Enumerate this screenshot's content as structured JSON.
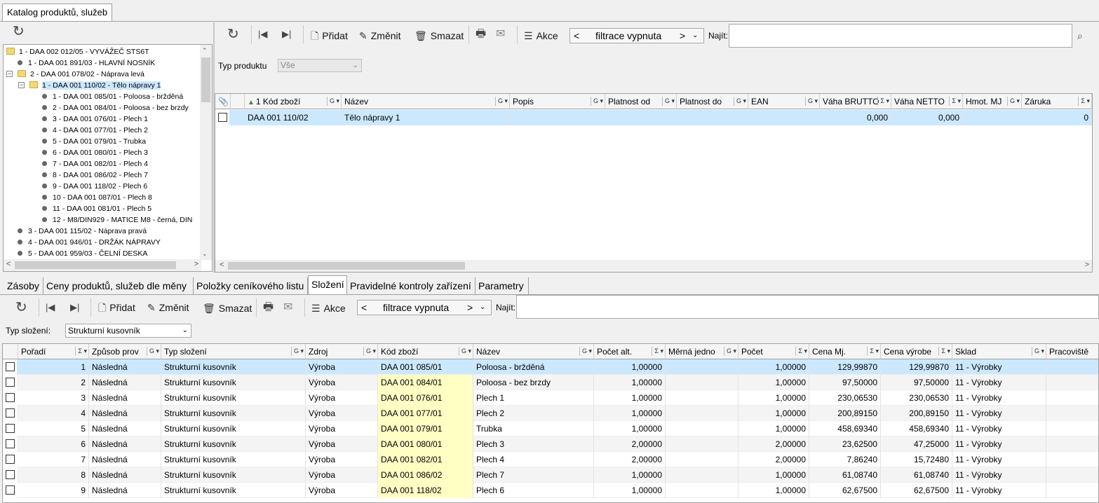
{
  "window": {
    "tab_title": "Katalog produktů, služeb"
  },
  "toolbar": {
    "add": "Přidat",
    "edit": "Změnit",
    "delete": "Smazat",
    "actions": "Akce",
    "filter_prev": "<",
    "filter_text": "filtrace vypnuta",
    "filter_next": ">",
    "find_label": "Najít:"
  },
  "top_filter": {
    "label": "Typ produktu",
    "value": "Vše"
  },
  "tree": [
    {
      "label": "1 - DAA 002 012/05 - VYVÁŽEČ STS6T",
      "level": 0,
      "type": "folder",
      "toggle": ""
    },
    {
      "label": "1 - DAA 001 891/03 - HLAVNÍ NOSNÍK",
      "level": 1,
      "type": "leaf",
      "toggle": ""
    },
    {
      "label": "2 - DAA 001 078/02 - Náprava levá",
      "level": 1,
      "type": "folder",
      "toggle": "−"
    },
    {
      "label": "1 - DAA 001 110/02 - Tělo nápravy 1",
      "level": 2,
      "type": "folder",
      "toggle": "−",
      "selected": true
    },
    {
      "label": "1 - DAA 001 085/01 - Poloosa - bržděná",
      "level": 3,
      "type": "leaf",
      "toggle": ""
    },
    {
      "label": "2 - DAA 001 084/01 - Poloosa - bez brzdy",
      "level": 3,
      "type": "leaf",
      "toggle": ""
    },
    {
      "label": "3 - DAA 001 076/01 - Plech 1",
      "level": 3,
      "type": "leaf",
      "toggle": ""
    },
    {
      "label": "4 - DAA 001 077/01 - Plech 2",
      "level": 3,
      "type": "leaf",
      "toggle": ""
    },
    {
      "label": "5 - DAA 001 079/01 - Trubka",
      "level": 3,
      "type": "leaf",
      "toggle": ""
    },
    {
      "label": "6 - DAA 001 080/01 - Plech 3",
      "level": 3,
      "type": "leaf",
      "toggle": ""
    },
    {
      "label": "7 - DAA 001 082/01 - Plech 4",
      "level": 3,
      "type": "leaf",
      "toggle": ""
    },
    {
      "label": "8 - DAA 001 086/02 - Plech 7",
      "level": 3,
      "type": "leaf",
      "toggle": ""
    },
    {
      "label": "9 - DAA 001 118/02 - Plech 6",
      "level": 3,
      "type": "leaf",
      "toggle": ""
    },
    {
      "label": "10 - DAA 001 087/01 - Plech 8",
      "level": 3,
      "type": "leaf",
      "toggle": ""
    },
    {
      "label": "11 - DAA 001 081/01 - Plech 5",
      "level": 3,
      "type": "leaf",
      "toggle": ""
    },
    {
      "label": "12 - M8/DIN929 - MATICE M8 - černá, DIN",
      "level": 3,
      "type": "leaf",
      "toggle": ""
    },
    {
      "label": "3 - DAA 001 115/02 - Náprava pravá",
      "level": 1,
      "type": "leaf",
      "toggle": ""
    },
    {
      "label": "4 - DAA 001 946/01 - DRŽÁK NÁPRAVY",
      "level": 1,
      "type": "leaf",
      "toggle": ""
    },
    {
      "label": "5 - DAA 001 959/03 - ČELNÍ DESKA",
      "level": 1,
      "type": "leaf",
      "toggle": ""
    }
  ],
  "product_grid": {
    "columns": [
      "1 Kód zboží",
      "Název",
      "Popis",
      "Platnost od",
      "Platnost do",
      "EAN",
      "Váha BRUTTO",
      "Váha NETTO",
      "Hmot. MJ",
      "Záruka"
    ],
    "rows": [
      {
        "code": "DAA 001 110/02",
        "name": "Tělo nápravy 1",
        "brutto": "0,000",
        "netto": "0,000",
        "warranty": "0"
      }
    ]
  },
  "bottom_tabs": [
    "Zásoby",
    "Ceny produktů, služeb dle měny",
    "Položky ceníkového listu",
    "Složení",
    "Pravidelné kontroly zařízení",
    "Parametry"
  ],
  "bottom_filter": {
    "label": "Typ složení:",
    "value": "Strukturní kusovník"
  },
  "composition_grid": {
    "columns": [
      "Pořadí",
      "Způsob prov",
      "Typ složení",
      "Zdroj",
      "Kód zboží",
      "Název",
      "Počet alt.",
      "Měrná jedno",
      "Počet",
      "Cena Mj.",
      "Cena výrobe",
      "Sklad",
      "Pracoviště"
    ],
    "rows": [
      [
        "1",
        "Následná",
        "Strukturní kusovník",
        "Výroba",
        "DAA 001 085/01",
        "Poloosa - bržděná",
        "1,00000",
        "",
        "1,00000",
        "129,99870",
        "129,99870",
        "11 - Výrobky"
      ],
      [
        "2",
        "Následná",
        "Strukturní kusovník",
        "Výroba",
        "DAA 001 084/01",
        "Poloosa - bez brzdy",
        "1,00000",
        "",
        "1,00000",
        "97,50000",
        "97,50000",
        "11 - Výrobky"
      ],
      [
        "3",
        "Následná",
        "Strukturní kusovník",
        "Výroba",
        "DAA 001 076/01",
        "Plech 1",
        "1,00000",
        "",
        "1,00000",
        "230,06530",
        "230,06530",
        "11 - Výrobky"
      ],
      [
        "4",
        "Následná",
        "Strukturní kusovník",
        "Výroba",
        "DAA 001 077/01",
        "Plech 2",
        "1,00000",
        "",
        "1,00000",
        "200,89150",
        "200,89150",
        "11 - Výrobky"
      ],
      [
        "5",
        "Následná",
        "Strukturní kusovník",
        "Výroba",
        "DAA 001 079/01",
        "Trubka",
        "1,00000",
        "",
        "1,00000",
        "458,69340",
        "458,69340",
        "11 - Výrobky"
      ],
      [
        "6",
        "Následná",
        "Strukturní kusovník",
        "Výroba",
        "DAA 001 080/01",
        "Plech 3",
        "2,00000",
        "",
        "2,00000",
        "23,62500",
        "47,25000",
        "11 - Výrobky"
      ],
      [
        "7",
        "Následná",
        "Strukturní kusovník",
        "Výroba",
        "DAA 001 082/01",
        "Plech 4",
        "2,00000",
        "",
        "2,00000",
        "7,86240",
        "15,72480",
        "11 - Výrobky"
      ],
      [
        "8",
        "Následná",
        "Strukturní kusovník",
        "Výroba",
        "DAA 001 086/02",
        "Plech 7",
        "1,00000",
        "",
        "1,00000",
        "61,08740",
        "61,08740",
        "11 - Výrobky"
      ],
      [
        "9",
        "Následná",
        "Strukturní kusovník",
        "Výroba",
        "DAA 001 118/02",
        "Plech 6",
        "1,00000",
        "",
        "1,00000",
        "62,67500",
        "62,67500",
        "11 - Výrobky"
      ]
    ]
  },
  "colors": {
    "selection": "#cce8ff",
    "code_highlight": "#ffffc4",
    "border": "#a0a0a0"
  }
}
